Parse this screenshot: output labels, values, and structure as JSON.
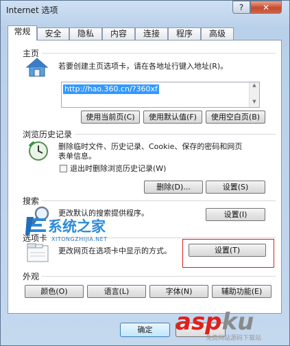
{
  "window": {
    "title": "Internet 选项",
    "help": "?",
    "close": "✕"
  },
  "tabs": [
    "常规",
    "安全",
    "隐私",
    "内容",
    "连接",
    "程序",
    "高级"
  ],
  "home": {
    "section": "主页",
    "desc": "若要创建主页选项卡，请在各地址行键入地址(R)。",
    "url": "http://hao.360.cn/?360xf",
    "buttons": [
      "使用当前页(C)",
      "使用默认值(F)",
      "使用空白页(B)"
    ]
  },
  "history": {
    "section": "浏览历史记录",
    "desc1": "删除临时文件、历史记录、Cookie、保存的密码和网页",
    "desc2": "表单信息。",
    "checkbox": "退出时删除浏览历史记录(W)",
    "delete_btn": "删除(D)...",
    "settings_btn": "设置(S)"
  },
  "search": {
    "section": "搜索",
    "desc": "更改默认的搜索提供程序。",
    "settings_btn": "设置(I)"
  },
  "tabsec": {
    "section": "选项卡",
    "desc": "更改网页在选项卡中显示的方式。",
    "settings_btn": "设置(T)"
  },
  "appearance": {
    "section": "外观",
    "buttons": [
      "颜色(O)",
      "语言(L)",
      "字体(N)",
      "辅助功能(E)"
    ]
  },
  "footer": {
    "ok": "确定",
    "cancel": ""
  },
  "watermark": {
    "title": "系统之家",
    "sub": "XITONGZHIJIA.NET"
  },
  "logo": {
    "asp": "asp",
    "ku": "ku",
    "caption": "免费网站源码下载站"
  },
  "colors": {
    "highlight": "#3399ff",
    "redbox": "#d02020",
    "asp": "#e0201b"
  }
}
